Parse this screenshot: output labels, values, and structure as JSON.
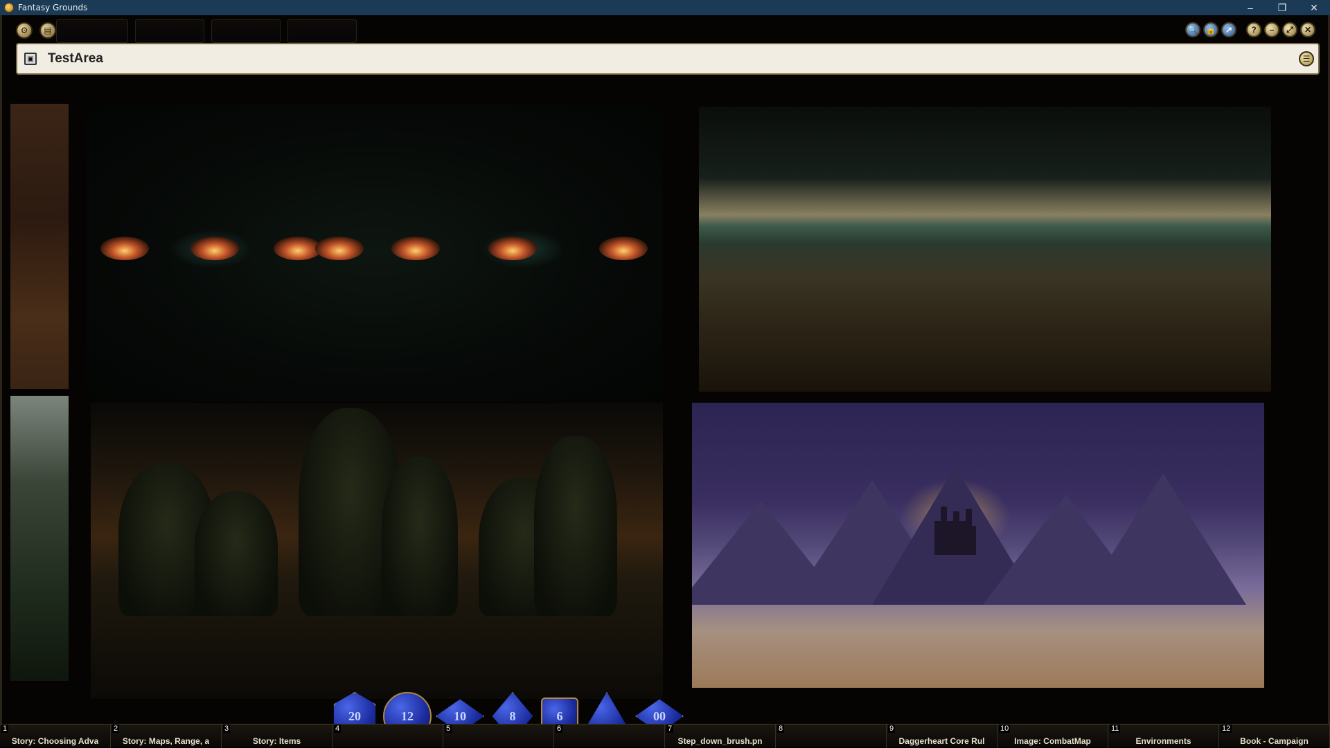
{
  "os_window": {
    "title": "Fantasy Grounds",
    "minimize_glyph": "–",
    "restore_glyph": "❐",
    "close_glyph": "✕"
  },
  "toolbar": {
    "left_buttons": [
      "options-icon",
      "library-icon"
    ],
    "right_buttons": [
      "zoom-icon",
      "lock-icon",
      "share-icon",
      "help-icon",
      "minimize-icon",
      "expand-icon",
      "close-icon"
    ],
    "right_glyphs": [
      "🔍",
      "🔒",
      "↗",
      "?",
      "–",
      "⤢",
      "✕"
    ]
  },
  "image_window": {
    "title": "TestArea",
    "icon": "image-window-icon",
    "menu_icon": "menu-icon"
  },
  "dice": [
    {
      "type": "d20",
      "face": "20"
    },
    {
      "type": "d12",
      "face": "12"
    },
    {
      "type": "d10",
      "face": "10"
    },
    {
      "type": "d8",
      "face": "8"
    },
    {
      "type": "d6",
      "face": "6"
    },
    {
      "type": "d4",
      "face": ""
    },
    {
      "type": "d100",
      "face": "00"
    }
  ],
  "hotkeys": [
    {
      "num": "1",
      "label": "Story: Choosing Adva"
    },
    {
      "num": "2",
      "label": "Story: Maps, Range, a"
    },
    {
      "num": "3",
      "label": "Story: Items"
    },
    {
      "num": "4",
      "label": ""
    },
    {
      "num": "5",
      "label": ""
    },
    {
      "num": "6",
      "label": ""
    },
    {
      "num": "7",
      "label": "Step_down_brush.pn"
    },
    {
      "num": "8",
      "label": ""
    },
    {
      "num": "9",
      "label": "Daggerheart Core Rul"
    },
    {
      "num": "10",
      "label": "Image: CombatMap"
    },
    {
      "num": "11",
      "label": "Environments"
    },
    {
      "num": "12",
      "label": "Book - Campaign"
    }
  ],
  "colors": {
    "os_titlebar": "#1a3a55",
    "window_header": "#f1ede2",
    "frame_gold": "#7b6a45",
    "dice_blue": "#1a2a9c"
  }
}
